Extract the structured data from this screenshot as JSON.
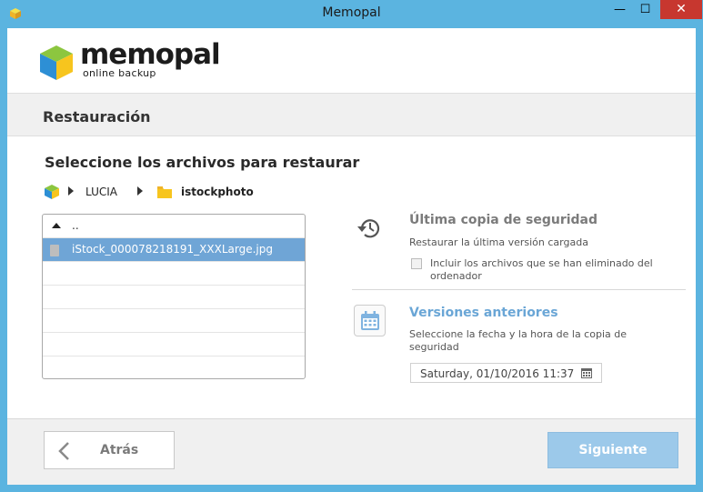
{
  "window": {
    "title": "Memopal",
    "minimize": "—",
    "maximize": "☐",
    "close": "✕"
  },
  "logo": {
    "name": "memopal",
    "tagline": "online backup"
  },
  "section": {
    "title": "Restauración"
  },
  "content": {
    "heading": "Seleccione los archivos para restaurar",
    "breadcrumb": [
      "LUCIA",
      "istockphoto"
    ]
  },
  "filelist": {
    "parent": "..",
    "files": [
      "iStock_000078218191_XXXLarge.jpg"
    ]
  },
  "options": {
    "last_backup": {
      "title": "Última copia de seguridad",
      "subtitle": "Restaurar la última versión cargada",
      "checkbox_label": "Incluir los archivos que se han eliminado del ordenador"
    },
    "previous": {
      "title": "Versiones anteriores",
      "subtitle": "Seleccione la fecha y la hora de la copia de seguridad",
      "date_value": "Saturday, 01/10/2016 11:37"
    }
  },
  "footer": {
    "back_label": "Atrás",
    "next_label": "Siguiente"
  },
  "colors": {
    "titlebar": "#5bb4e0",
    "accent": "#6aa6d6",
    "selection": "#6fa5d6",
    "next_button": "#9cc9ea",
    "close_button": "#c7372f"
  }
}
